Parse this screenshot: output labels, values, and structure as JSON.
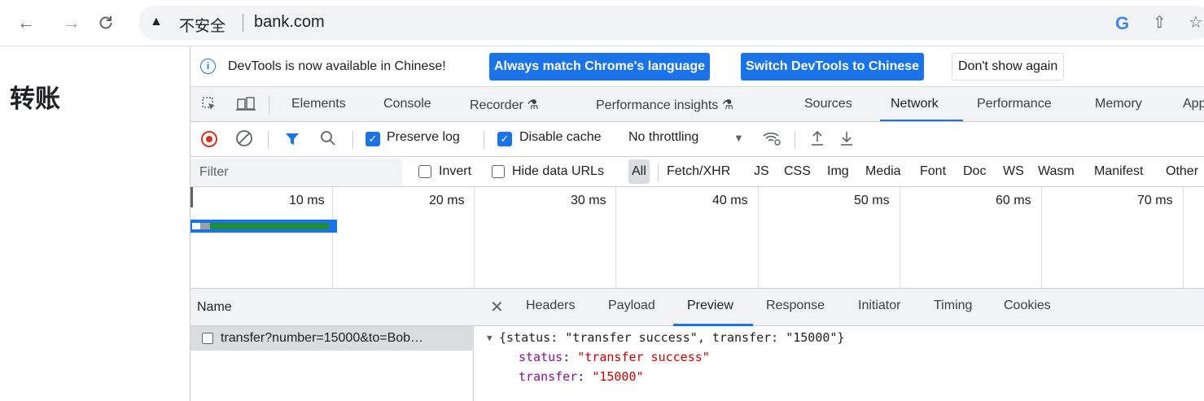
{
  "browser": {
    "security_label": "不安全",
    "url": "bank.com"
  },
  "page": {
    "title": "转账"
  },
  "devtools": {
    "infobar": {
      "message": "DevTools is now available in Chinese!",
      "always_match_label": "Always match Chrome's language",
      "switch_label": "Switch DevTools to Chinese",
      "dont_show_label": "Don't show again"
    },
    "tabs": [
      "Elements",
      "Console",
      "Recorder ⚗",
      "Performance insights ⚗",
      "Sources",
      "Network",
      "Performance",
      "Memory",
      "Application"
    ],
    "active_tab": "Network",
    "network_toolbar": {
      "preserve_log_label": "Preserve log",
      "preserve_log_checked": true,
      "disable_cache_label": "Disable cache",
      "disable_cache_checked": true,
      "throttling_value": "No throttling"
    },
    "filter": {
      "placeholder": "Filter",
      "invert_label": "Invert",
      "hide_data_urls_label": "Hide data URLs",
      "types": [
        "All",
        "Fetch/XHR",
        "JS",
        "CSS",
        "Img",
        "Media",
        "Font",
        "Doc",
        "WS",
        "Wasm",
        "Manifest",
        "Other"
      ],
      "active_type": "All"
    },
    "overview": {
      "ticks": [
        "10 ms",
        "20 ms",
        "30 ms",
        "40 ms",
        "50 ms",
        "60 ms",
        "70 ms"
      ]
    },
    "request_list": {
      "column_header": "Name",
      "rows": [
        {
          "name": "transfer?number=15000&to=Bob…"
        }
      ]
    },
    "detail": {
      "tabs": [
        "Headers",
        "Payload",
        "Preview",
        "Response",
        "Initiator",
        "Timing",
        "Cookies"
      ],
      "active_tab": "Preview",
      "preview": {
        "summary": "{status: \"transfer success\", transfer: \"15000\"}",
        "fields": [
          {
            "key": "status",
            "value": "\"transfer success\""
          },
          {
            "key": "transfer",
            "value": "\"15000\""
          }
        ]
      }
    }
  },
  "colors": {
    "accent": "#1a73e8",
    "record": "#d93025",
    "waterfall_green": "#1e8e3e",
    "json_key": "#881391",
    "json_string": "#c80000"
  }
}
